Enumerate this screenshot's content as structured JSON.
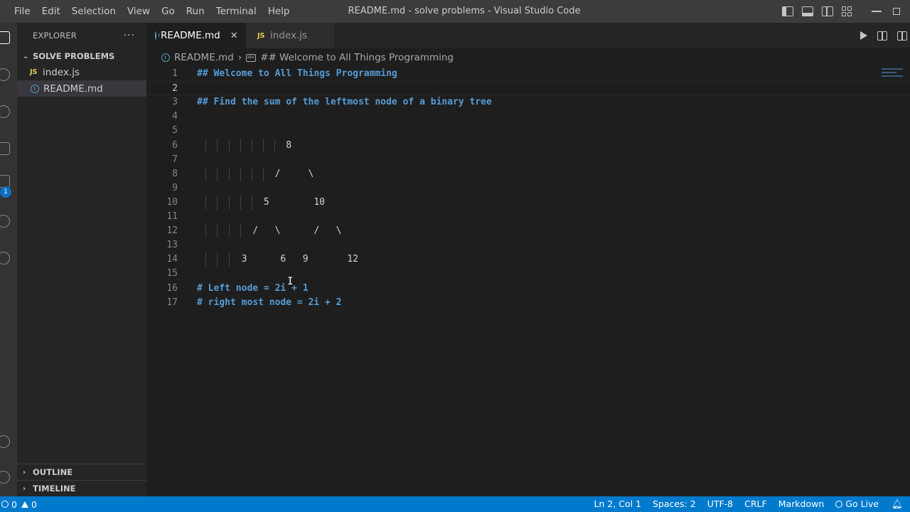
{
  "window": {
    "title": "README.md - solve problems - Visual Studio Code",
    "menu": [
      "File",
      "Edit",
      "Selection",
      "View",
      "Go",
      "Run",
      "Terminal",
      "Help"
    ]
  },
  "sidebar": {
    "title": "EXPLORER",
    "more": "···",
    "folder": "SOLVE PROBLEMS",
    "files": [
      {
        "label": "index.js",
        "icon": "js-icon",
        "badge": "JS"
      },
      {
        "label": "README.md",
        "icon": "info-icon",
        "selected": true
      }
    ],
    "outline": "OUTLINE",
    "timeline": "TIMELINE"
  },
  "activitybar": {
    "badge": "1"
  },
  "tabs": [
    {
      "label": "README.md",
      "active": true,
      "icon": "info-icon",
      "close": "✕"
    },
    {
      "label": "index.js",
      "active": false,
      "icon": "js-icon",
      "badge": "JS"
    }
  ],
  "breadcrumb": {
    "file": "README.md",
    "separator": "›",
    "symbol": "## Welcome to All Things Programming"
  },
  "editor": {
    "current_line": 2,
    "lines": [
      {
        "n": "1",
        "text": "## Welcome to All Things Programming",
        "kind": "heading"
      },
      {
        "n": "2",
        "text": "",
        "kind": "plain"
      },
      {
        "n": "3",
        "text": "## Find the sum of the leftmost node of a binary tree",
        "kind": "heading"
      },
      {
        "n": "4",
        "text": "",
        "kind": "plain"
      },
      {
        "n": "5",
        "text": "",
        "kind": "plain"
      },
      {
        "n": "6",
        "text": "                8",
        "kind": "plain"
      },
      {
        "n": "7",
        "text": "",
        "kind": "plain"
      },
      {
        "n": "8",
        "text": "              /     \\",
        "kind": "plain"
      },
      {
        "n": "9",
        "text": "",
        "kind": "plain"
      },
      {
        "n": "10",
        "text": "            5        10",
        "kind": "plain"
      },
      {
        "n": "11",
        "text": "",
        "kind": "plain"
      },
      {
        "n": "12",
        "text": "          /   \\      /   \\",
        "kind": "plain"
      },
      {
        "n": "13",
        "text": "",
        "kind": "plain"
      },
      {
        "n": "14",
        "text": "        3      6   9       12",
        "kind": "plain"
      },
      {
        "n": "15",
        "text": "",
        "kind": "plain"
      },
      {
        "n": "16",
        "text": "# Left node = 2i + 1",
        "kind": "heading"
      },
      {
        "n": "17",
        "text": "# right most node = 2i + 2",
        "kind": "heading"
      }
    ]
  },
  "statusbar": {
    "errors": "0",
    "warnings": "0",
    "position": "Ln 2, Col 1",
    "spaces": "Spaces: 2",
    "encoding": "UTF-8",
    "eol": "CRLF",
    "language": "Markdown",
    "golive": "Go Live"
  },
  "colors": {
    "accent": "#007acc",
    "heading": "#569cd6",
    "js": "#e6d04c",
    "markdown_info": "#519aba"
  }
}
